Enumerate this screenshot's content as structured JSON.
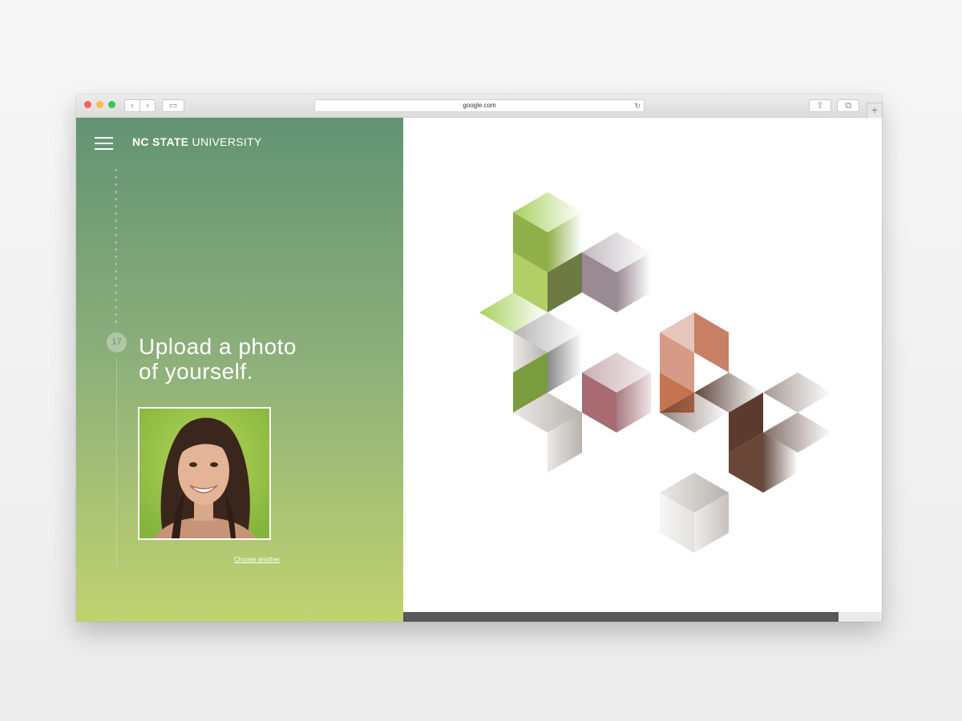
{
  "browser": {
    "url": "google.com",
    "icons": {
      "back": "chevron-left-icon",
      "forward": "chevron-right-icon",
      "sidebar": "sidebar-icon",
      "reload": "reload-icon",
      "share": "share-icon",
      "tabs": "tabs-icon",
      "new_tab": "plus-icon"
    },
    "glyphs": {
      "back": "‹",
      "forward": "›",
      "sidebar": "▭",
      "reload": "↻",
      "share": "⇪",
      "tabs": "⧉",
      "new_tab": "+"
    }
  },
  "site": {
    "logo_bold": "NC STATE",
    "logo_light": "UNIVERSITY",
    "menu_icon": "hamburger-menu-icon"
  },
  "form": {
    "step_number": "17",
    "heading_line1": "Upload a photo",
    "heading_line2": "of yourself.",
    "choose_another": "Choose another"
  },
  "progress": {
    "fraction": 0.91
  },
  "colors": {
    "panel_top": "#629373",
    "panel_bottom": "#c0d26f",
    "progress_bar": "#58595b"
  }
}
